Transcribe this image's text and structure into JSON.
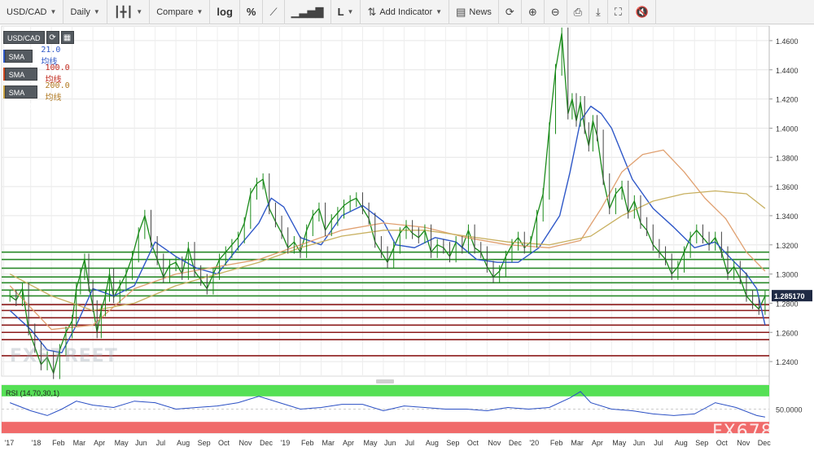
{
  "toolbar": {
    "symbol": "USD/CAD",
    "interval": "Daily",
    "compare": "Compare",
    "log": "log",
    "percent": "%",
    "line_type": "L",
    "add_indicator": "Add Indicator",
    "news": "News"
  },
  "legend": {
    "symbol": "USD/CAD",
    "sma21_box": "SMA (21,0)",
    "sma21_text": "21.0均线",
    "sma100_box": "SMA (100,0)",
    "sma100_text": "100.0均线",
    "sma200_box": "SMA (200,0)",
    "sma200_text": "200.0均线"
  },
  "rsi": {
    "label": "RSI (14,70,30,1)"
  },
  "watermarks": {
    "left": "FXSTREET",
    "right": "FX678"
  },
  "colors": {
    "price": "#1a8a1a",
    "price_down": "#444444",
    "sma21": "#2f58c8",
    "sma100": "#e0a070",
    "sma200": "#c8b060",
    "support": "#8b1a1a",
    "resistance": "#2a8a2a",
    "rsi_line": "#2a4fc4",
    "rsi_over": "#55e055",
    "rsi_under": "#f06a6a",
    "last_price_bg": "#1f2a44"
  },
  "chart_data": {
    "type": "line",
    "title": "USD/CAD",
    "ylim": [
      1.23,
      1.47
    ],
    "y_ticks": [
      "1.4600",
      "1.4400",
      "1.4200",
      "1.4000",
      "1.3800",
      "1.3600",
      "1.3400",
      "1.3200",
      "1.3000",
      "1.2800",
      "1.2600",
      "1.2400"
    ],
    "last_price": "1.285170",
    "x_labels": [
      "'17",
      "'18",
      "Feb",
      "Mar",
      "Apr",
      "May",
      "Jun",
      "Jul",
      "Aug",
      "Sep",
      "Oct",
      "Nov",
      "Dec",
      "'19",
      "Feb",
      "Mar",
      "Apr",
      "May",
      "Jun",
      "Jul",
      "Aug",
      "Sep",
      "Oct",
      "Nov",
      "Dec",
      "'20",
      "Feb",
      "Mar",
      "Apr",
      "May",
      "Jun",
      "Jul",
      "Aug",
      "Sep",
      "Oct",
      "Nov",
      "Dec"
    ],
    "x_months": [
      -0.3,
      1,
      2,
      3,
      4,
      5,
      6,
      7,
      8,
      9,
      10,
      11,
      12,
      13,
      14,
      15,
      16,
      17,
      18,
      19,
      20,
      21,
      22,
      23,
      24,
      25,
      26,
      27,
      28,
      29,
      30,
      31,
      32,
      33,
      34,
      35,
      36
    ],
    "xlim": [
      -0.4,
      36.6
    ],
    "series": [
      {
        "name": "USD/CAD",
        "x": [
          0,
          0.3,
          0.6,
          0.9,
          1.2,
          1.5,
          1.8,
          2.1,
          2.4,
          2.7,
          3.0,
          3.2,
          3.4,
          3.6,
          3.8,
          4.0,
          4.2,
          4.4,
          4.6,
          4.8,
          5.0,
          5.3,
          5.6,
          5.9,
          6.2,
          6.5,
          6.8,
          7.1,
          7.4,
          7.7,
          8.0,
          8.3,
          8.6,
          8.9,
          9.2,
          9.5,
          9.8,
          10.1,
          10.4,
          10.7,
          11.0,
          11.3,
          11.6,
          11.9,
          12.2,
          12.5,
          12.8,
          13.1,
          13.4,
          13.7,
          14.0,
          14.3,
          14.6,
          14.9,
          15.2,
          15.5,
          15.8,
          16.1,
          16.4,
          16.7,
          17.0,
          17.3,
          17.6,
          17.9,
          18.2,
          18.5,
          18.8,
          19.1,
          19.4,
          19.7,
          20.0,
          20.3,
          20.6,
          20.9,
          21.2,
          21.5,
          21.8,
          22.1,
          22.4,
          22.7,
          23.0,
          23.3,
          23.6,
          23.9,
          24.2,
          24.5,
          24.8,
          25.1,
          25.4,
          25.7,
          26.0,
          26.3,
          26.6,
          26.9,
          27.1,
          27.3,
          27.5,
          27.7,
          27.9,
          28.1,
          28.3,
          28.6,
          28.9,
          29.2,
          29.5,
          29.8,
          30.1,
          30.4,
          30.7,
          31.0,
          31.3,
          31.6,
          31.9,
          32.2,
          32.5,
          32.8,
          33.1,
          33.4,
          33.7,
          34.0,
          34.3,
          34.6,
          34.9,
          35.2,
          35.5,
          35.8,
          36.1,
          36.4
        ],
        "values": [
          1.285,
          1.282,
          1.29,
          1.262,
          1.25,
          1.238,
          1.243,
          1.232,
          1.248,
          1.26,
          1.268,
          1.29,
          1.3,
          1.31,
          1.292,
          1.278,
          1.26,
          1.275,
          1.285,
          1.3,
          1.284,
          1.292,
          1.3,
          1.312,
          1.328,
          1.34,
          1.322,
          1.31,
          1.298,
          1.306,
          1.308,
          1.3,
          1.318,
          1.302,
          1.296,
          1.29,
          1.3,
          1.31,
          1.315,
          1.32,
          1.325,
          1.335,
          1.355,
          1.362,
          1.365,
          1.345,
          1.336,
          1.328,
          1.318,
          1.322,
          1.315,
          1.33,
          1.34,
          1.345,
          1.33,
          1.337,
          1.342,
          1.347,
          1.35,
          1.352,
          1.345,
          1.338,
          1.322,
          1.315,
          1.308,
          1.318,
          1.328,
          1.333,
          1.328,
          1.325,
          1.33,
          1.315,
          1.32,
          1.318,
          1.312,
          1.322,
          1.318,
          1.33,
          1.318,
          1.315,
          1.305,
          1.298,
          1.302,
          1.312,
          1.32,
          1.325,
          1.318,
          1.322,
          1.34,
          1.355,
          1.4,
          1.44,
          1.465,
          1.41,
          1.42,
          1.405,
          1.418,
          1.4,
          1.388,
          1.405,
          1.395,
          1.365,
          1.345,
          1.355,
          1.36,
          1.342,
          1.35,
          1.335,
          1.33,
          1.32,
          1.315,
          1.31,
          1.3,
          1.305,
          1.315,
          1.325,
          1.33,
          1.325,
          1.32,
          1.325,
          1.315,
          1.3,
          1.305,
          1.297,
          1.285,
          1.28,
          1.276,
          1.285
        ]
      },
      {
        "name": "SMA (21,0)",
        "x": [
          0,
          1,
          1.8,
          2.5,
          3.2,
          4.0,
          5.0,
          6.0,
          7.0,
          8.0,
          9.0,
          10.0,
          11.0,
          12.0,
          12.6,
          13.2,
          14.0,
          15.0,
          16.0,
          17.0,
          18.0,
          18.6,
          19.5,
          20.5,
          21.5,
          22.5,
          23.5,
          24.5,
          25.5,
          26.5,
          27.0,
          27.5,
          28.0,
          28.5,
          29.0,
          30.0,
          31.0,
          32.0,
          33.0,
          34.0,
          34.8,
          35.5,
          36.0,
          36.4
        ],
        "values": [
          1.275,
          1.262,
          1.248,
          1.246,
          1.265,
          1.29,
          1.285,
          1.292,
          1.322,
          1.312,
          1.304,
          1.3,
          1.318,
          1.335,
          1.352,
          1.346,
          1.325,
          1.32,
          1.34,
          1.347,
          1.336,
          1.32,
          1.318,
          1.325,
          1.322,
          1.31,
          1.308,
          1.308,
          1.318,
          1.34,
          1.37,
          1.405,
          1.415,
          1.41,
          1.4,
          1.365,
          1.345,
          1.332,
          1.318,
          1.322,
          1.31,
          1.3,
          1.29,
          1.265
        ]
      },
      {
        "name": "SMA (100,0)",
        "x": [
          0,
          2,
          4,
          6,
          8,
          10,
          12,
          14,
          16,
          18,
          20,
          22,
          24,
          26,
          27.5,
          28.5,
          29.5,
          30.5,
          31.5,
          32.5,
          33.5,
          34.5,
          35.5,
          36.4
        ],
        "values": [
          1.292,
          1.262,
          1.265,
          1.29,
          1.3,
          1.305,
          1.31,
          1.32,
          1.33,
          1.335,
          1.332,
          1.325,
          1.32,
          1.318,
          1.323,
          1.345,
          1.37,
          1.382,
          1.385,
          1.37,
          1.352,
          1.338,
          1.315,
          1.302
        ]
      },
      {
        "name": "SMA (200,0)",
        "x": [
          0,
          2,
          4,
          6,
          8,
          10,
          12,
          14,
          16,
          18,
          20,
          22,
          24,
          26,
          28,
          29.5,
          31,
          32.5,
          34,
          35.5,
          36.4
        ],
        "values": [
          1.3,
          1.285,
          1.275,
          1.28,
          1.292,
          1.3,
          1.308,
          1.318,
          1.326,
          1.33,
          1.33,
          1.326,
          1.322,
          1.32,
          1.326,
          1.34,
          1.35,
          1.355,
          1.357,
          1.355,
          1.345
        ]
      }
    ],
    "horizontal_levels": {
      "green": [
        1.315,
        1.31,
        1.304,
        1.298,
        1.294,
        1.289,
        1.285
      ],
      "red": [
        1.279,
        1.275,
        1.27,
        1.265,
        1.26,
        1.255,
        1.244
      ]
    },
    "rsi": {
      "ylim": [
        20,
        80
      ],
      "y_ticks": [
        "50.0000"
      ],
      "overbought": 70,
      "oversold": 30,
      "x": [
        0,
        1,
        1.8,
        2.5,
        3.2,
        4.0,
        5.0,
        6.0,
        7.0,
        8.0,
        9.0,
        10.0,
        11.0,
        12.0,
        13.0,
        14.0,
        15.0,
        16.0,
        17.0,
        18.0,
        19.0,
        20.0,
        21.0,
        22.0,
        23.0,
        24.0,
        25.0,
        26.0,
        27.0,
        27.5,
        28.0,
        29.0,
        30.0,
        31.0,
        32.0,
        33.0,
        34.0,
        35.0,
        36.0,
        36.4
      ],
      "values": [
        58,
        48,
        42,
        50,
        60,
        55,
        52,
        60,
        58,
        50,
        52,
        54,
        58,
        66,
        58,
        50,
        52,
        56,
        56,
        48,
        54,
        52,
        50,
        50,
        48,
        52,
        50,
        52,
        64,
        72,
        58,
        50,
        48,
        44,
        42,
        44,
        58,
        52,
        42,
        40
      ]
    }
  }
}
